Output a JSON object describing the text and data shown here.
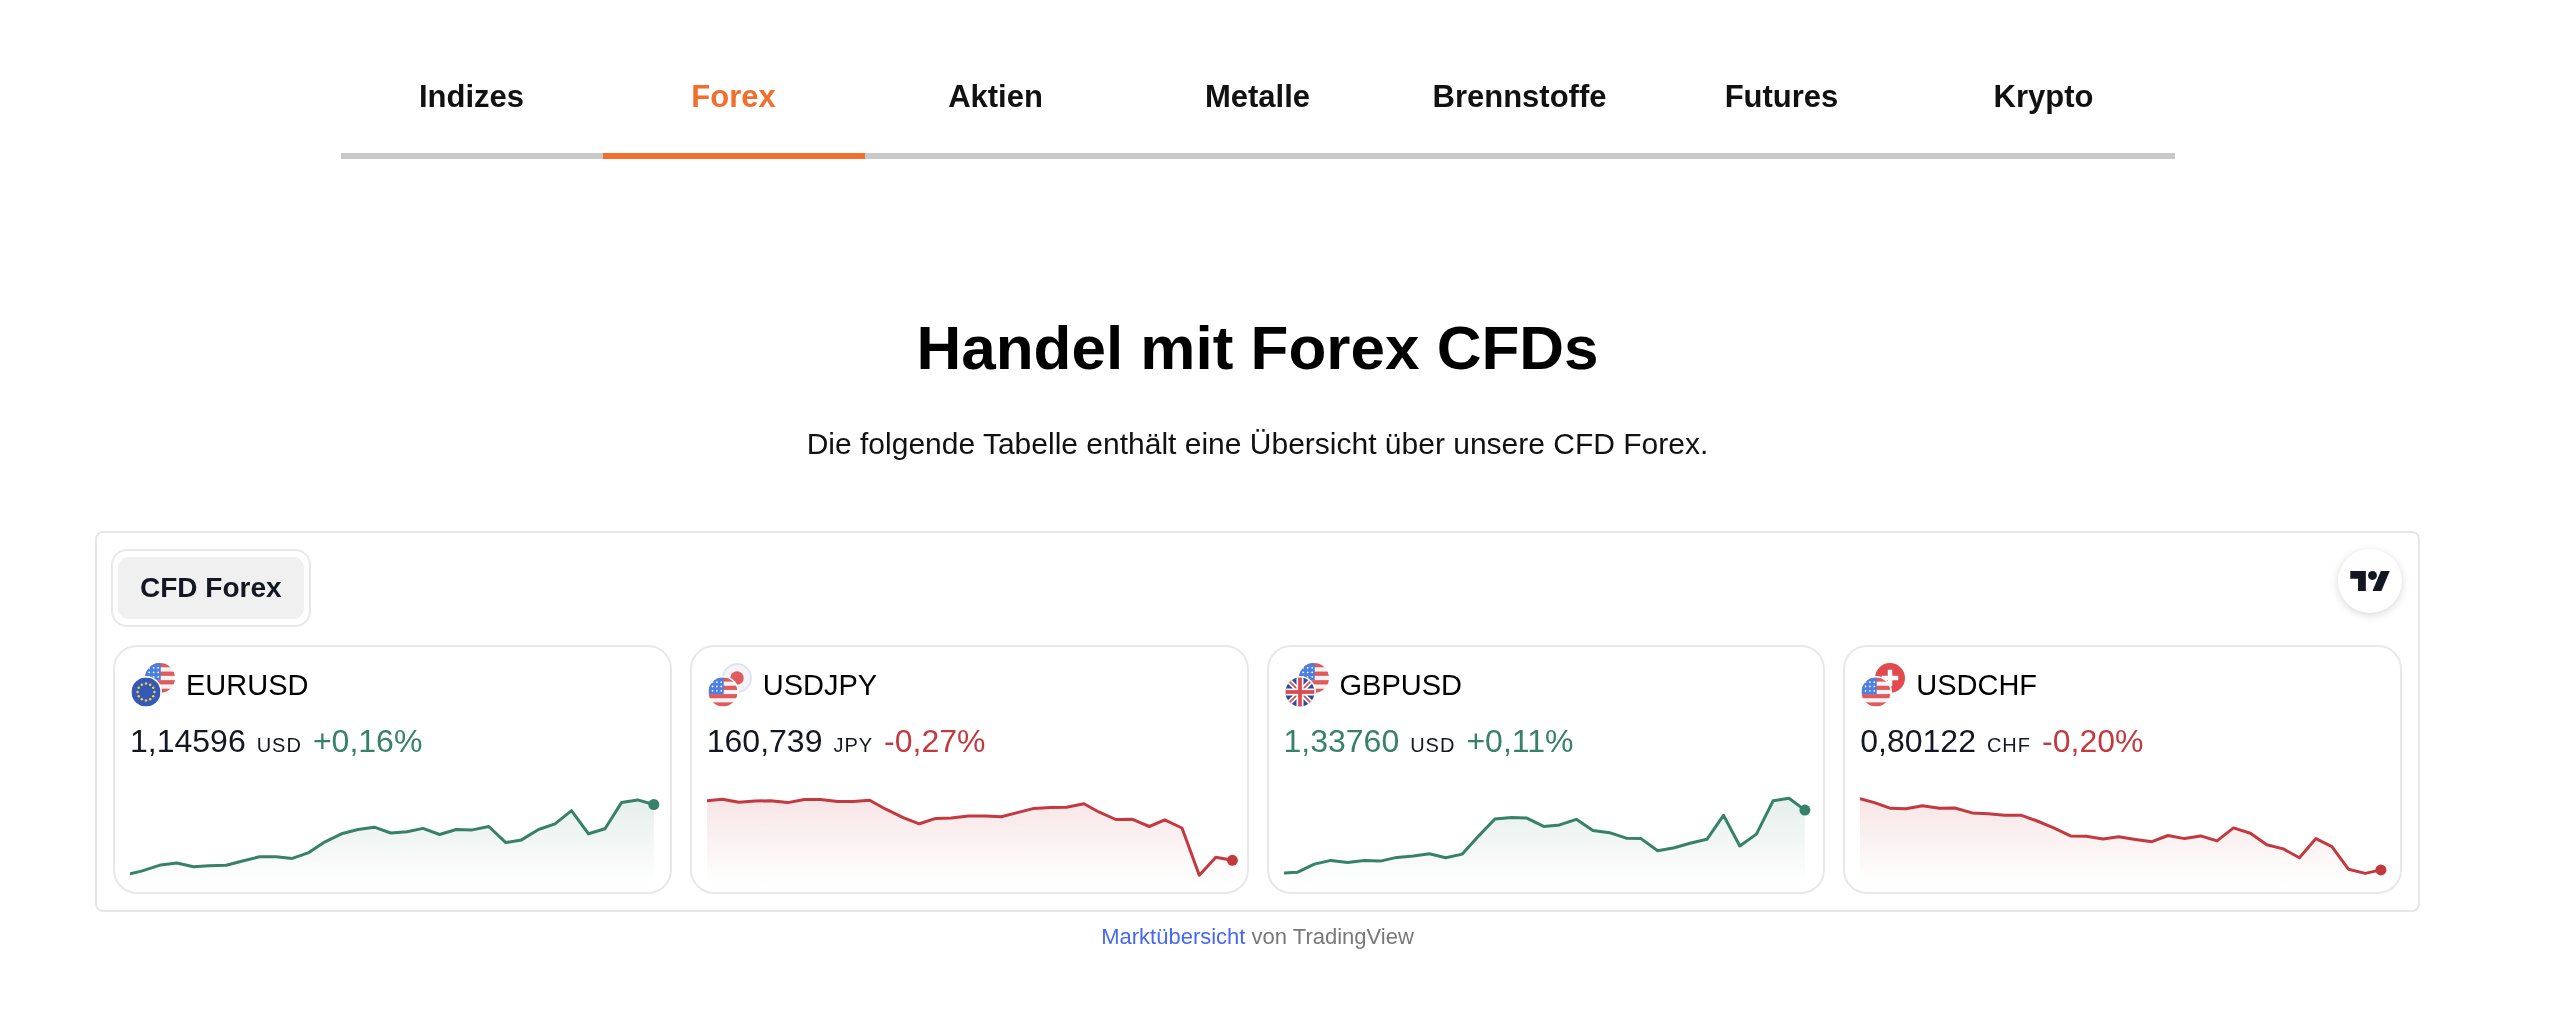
{
  "tabs": [
    {
      "label": "Indizes",
      "selected": false
    },
    {
      "label": "Forex",
      "selected": true
    },
    {
      "label": "Aktien",
      "selected": false
    },
    {
      "label": "Metalle",
      "selected": false
    },
    {
      "label": "Brennstoffe",
      "selected": false
    },
    {
      "label": "Futures",
      "selected": false
    },
    {
      "label": "Krypto",
      "selected": false
    }
  ],
  "heading": "Handel mit Forex CFDs",
  "subtitle": "Die folgende Tabelle enthält eine Übersicht über unsere CFD Forex.",
  "widget": {
    "tabs": [
      {
        "label": "CFD Forex",
        "selected": true
      }
    ],
    "quotes": [
      {
        "symbol": "EURUSD",
        "price": "1,14596",
        "currency": "USD",
        "change": "+0,16%",
        "rising": true,
        "price_highlighted": false
      },
      {
        "symbol": "USDJPY",
        "price": "160,739",
        "currency": "JPY",
        "change": "-0,27%",
        "rising": false,
        "price_highlighted": false
      },
      {
        "symbol": "GBPUSD",
        "price": "1,33760",
        "currency": "USD",
        "change": "+0,11%",
        "rising": true,
        "price_highlighted": true
      },
      {
        "symbol": "USDCHF",
        "price": "0,80122",
        "currency": "CHF",
        "change": "-0,20%",
        "rising": false,
        "price_highlighted": false
      }
    ]
  },
  "attribution": {
    "link": "Marktübersicht",
    "text": "von TradingView"
  }
}
